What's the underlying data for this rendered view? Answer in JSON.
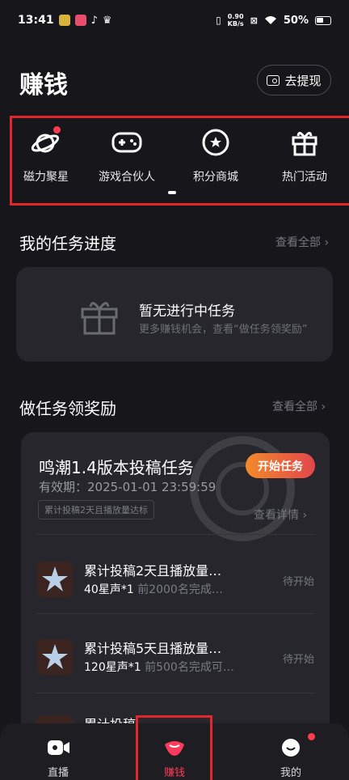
{
  "status_bar": {
    "time": "13:41",
    "net_speed_value": "0.90",
    "net_speed_unit": "KB/s",
    "battery": "50%"
  },
  "header": {
    "title": "赚钱",
    "withdraw_label": "去提现",
    "withdraw_icon": "wallet-icon"
  },
  "shortcuts": [
    {
      "label": "磁力聚星",
      "icon": "planet-icon",
      "has_dot": true
    },
    {
      "label": "游戏合伙人",
      "icon": "gamepad-icon",
      "has_dot": false
    },
    {
      "label": "积分商城",
      "icon": "star-coin-icon",
      "has_dot": false
    },
    {
      "label": "热门活动",
      "icon": "gift-icon",
      "has_dot": false
    }
  ],
  "my_tasks": {
    "title": "我的任务进度",
    "view_all": "查看全部 ›",
    "empty_title": "暂无进行中任务",
    "empty_subtitle": "更多赚钱机会，查看“做任务领奖励”"
  },
  "rewards": {
    "title": "做任务领奖励",
    "view_all": "查看全部 ›",
    "card": {
      "title": "鸣潮1.4版本投稿任务",
      "validity": "有效期：2025-01-01 23:59:59",
      "start_label": "开始任务",
      "tag": "累计投稿2天且播放量达标",
      "detail_label": "查看详情 ›",
      "sub_tasks": [
        {
          "title": "累计投稿2天且播放量…",
          "reward": "40星声*1",
          "progress": "前2000名完成…",
          "status": "待开始"
        },
        {
          "title": " 累计投稿5天且播放量…",
          "reward": "120星声*1",
          "progress": "前500名完成可…",
          "status": "待开始"
        },
        {
          "title": "累计投稿…"
        }
      ]
    }
  },
  "tabbar": {
    "items": [
      {
        "label": "直播",
        "icon": "live-camera-icon"
      },
      {
        "label": "赚钱",
        "icon": "money-lips-icon",
        "active": true
      },
      {
        "label": "我的",
        "icon": "smile-face-icon",
        "has_dot": true
      }
    ]
  },
  "colors": {
    "background": "#17171b",
    "card": "#26262c",
    "accent_red": "#ff3b5c",
    "button_gradient_start": "#f28a2a",
    "button_gradient_end": "#e2464c"
  }
}
